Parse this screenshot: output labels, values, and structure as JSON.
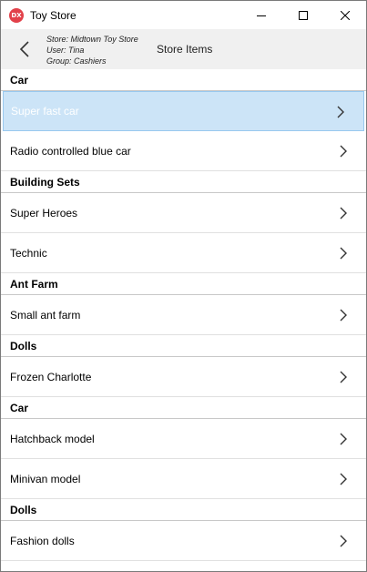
{
  "window": {
    "icon_label": "DX",
    "title": "Toy Store",
    "controls": [
      "minimize",
      "maximize",
      "close"
    ]
  },
  "header": {
    "store": "Store: Midtown Toy Store",
    "user": "User: Tina",
    "group": "Group: Cashiers",
    "title": "Store Items"
  },
  "list": {
    "groups": [
      {
        "name": "Car",
        "items": [
          "Super fast car",
          "Radio controlled blue car"
        ]
      },
      {
        "name": "Building Sets",
        "items": [
          "Super Heroes",
          "Technic"
        ]
      },
      {
        "name": "Ant Farm",
        "items": [
          "Small ant farm"
        ]
      },
      {
        "name": "Dolls",
        "items": [
          "Frozen Charlotte"
        ]
      },
      {
        "name": "Car",
        "items": [
          "Hatchback model",
          "Minivan model"
        ]
      },
      {
        "name": "Dolls",
        "items": [
          "Fashion dolls"
        ]
      }
    ],
    "selected_item": "Super fast car"
  },
  "colors": {
    "selected_background": "#cce4f7",
    "selected_border": "#99c9ef",
    "header_background": "#f0f0f0",
    "app_icon": "#e2414a"
  },
  "icons": [
    "app-logo-icon",
    "minimize-icon",
    "maximize-icon",
    "close-icon",
    "back-arrow-icon",
    "chevron-right-icon"
  ]
}
